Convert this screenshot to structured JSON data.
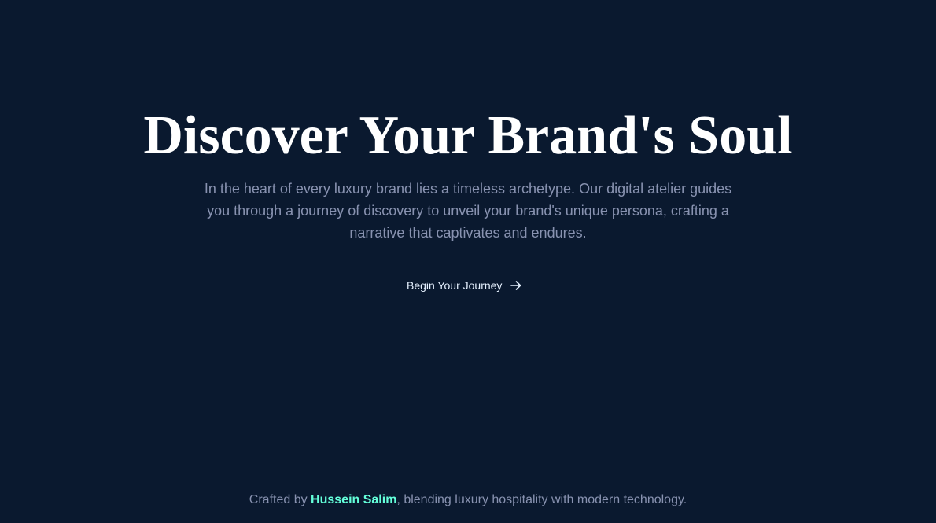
{
  "hero": {
    "title": "Discover Your Brand's Soul",
    "subtitle": "In the heart of every luxury brand lies a timeless archetype. Our digital atelier guides you through a journey of discovery to unveil your brand's unique persona, crafting a narrative that captivates and endures.",
    "cta_label": "Begin Your Journey",
    "cta_icon": "arrow-right-icon"
  },
  "footer": {
    "prefix": "Crafted by ",
    "author": "Hussein Salim",
    "suffix": ", blending luxury hospitality with modern technology."
  },
  "colors": {
    "background": "#0a192f",
    "title": "#ffffff",
    "body_text": "#8892b0",
    "cta_text": "#e6f1ff",
    "accent": "#64ffda"
  }
}
